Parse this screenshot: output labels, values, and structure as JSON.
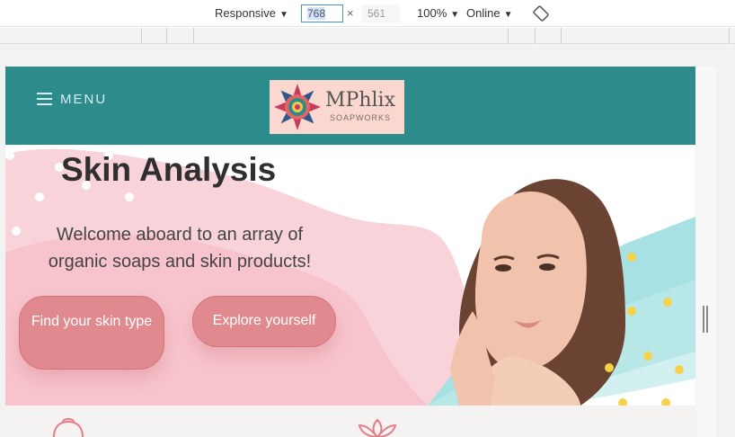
{
  "devtools": {
    "device": "Responsive",
    "width": "768",
    "times": "×",
    "height": "561",
    "zoom": "100%",
    "network": "Online",
    "rotate_icon": "rotate-icon"
  },
  "site": {
    "menu_label": "MENU",
    "logo": {
      "name": "MPhlix",
      "tagline": "SOAPWORKS"
    },
    "hero": {
      "title": "Skin Analysis",
      "subtitle": "Welcome aboard to an array of organic soaps and skin products!",
      "buttons": [
        {
          "label": "Find your skin type"
        },
        {
          "label": "Explore yourself"
        }
      ]
    }
  },
  "colors": {
    "header": "#2d8b8c",
    "button": "#e08a8f",
    "hero_blob": "#f9d3da",
    "teal_stroke": "#a8e1e3",
    "dots": "#f5d24a"
  }
}
